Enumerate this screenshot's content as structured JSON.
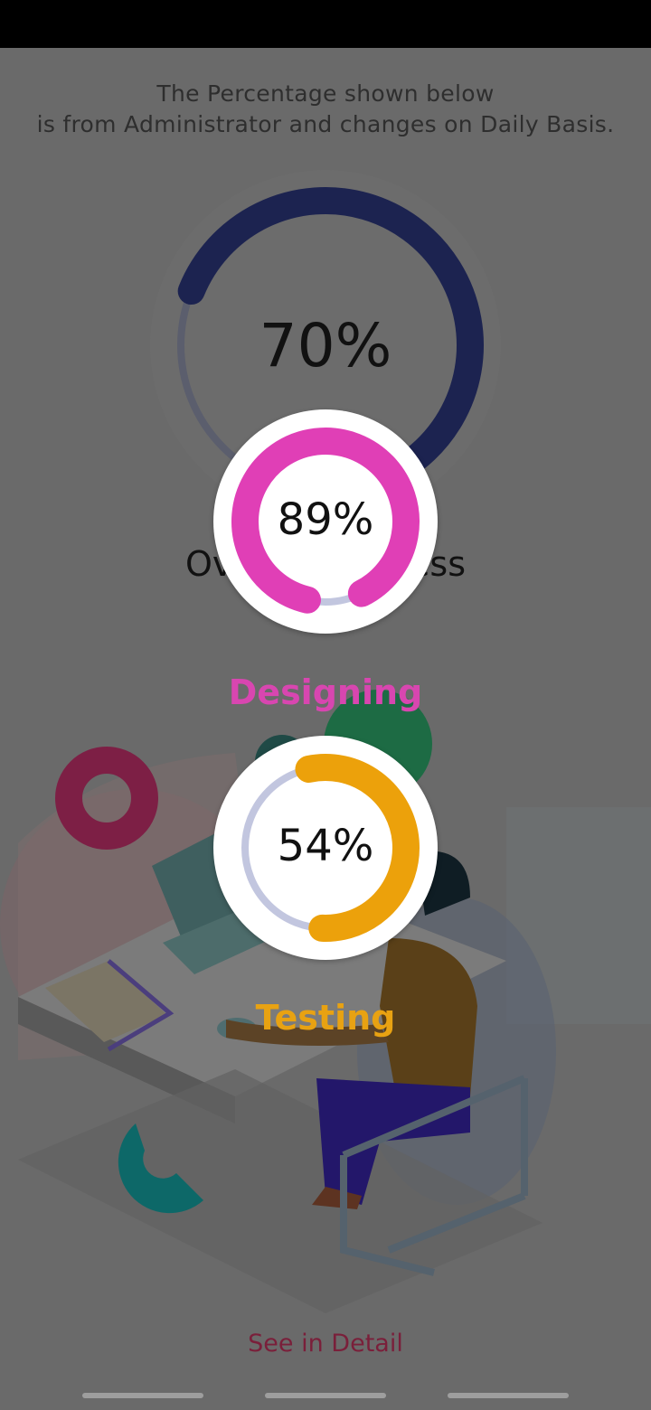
{
  "intro": {
    "line1": "The Percentage shown below",
    "line2": "is from Administrator and changes on Daily Basis."
  },
  "overall": {
    "value_text": "70%",
    "percent": 70,
    "label": "Overall Progress",
    "color": "#1c2350"
  },
  "designing": {
    "value_text": "89%",
    "percent": 89,
    "label": "Designing",
    "color": "#e03fb6"
  },
  "testing": {
    "value_text": "54%",
    "percent": 54,
    "label": "Testing",
    "color": "#eca10b"
  },
  "track_color": "#c2c6df",
  "detail_link": "See in Detail"
}
